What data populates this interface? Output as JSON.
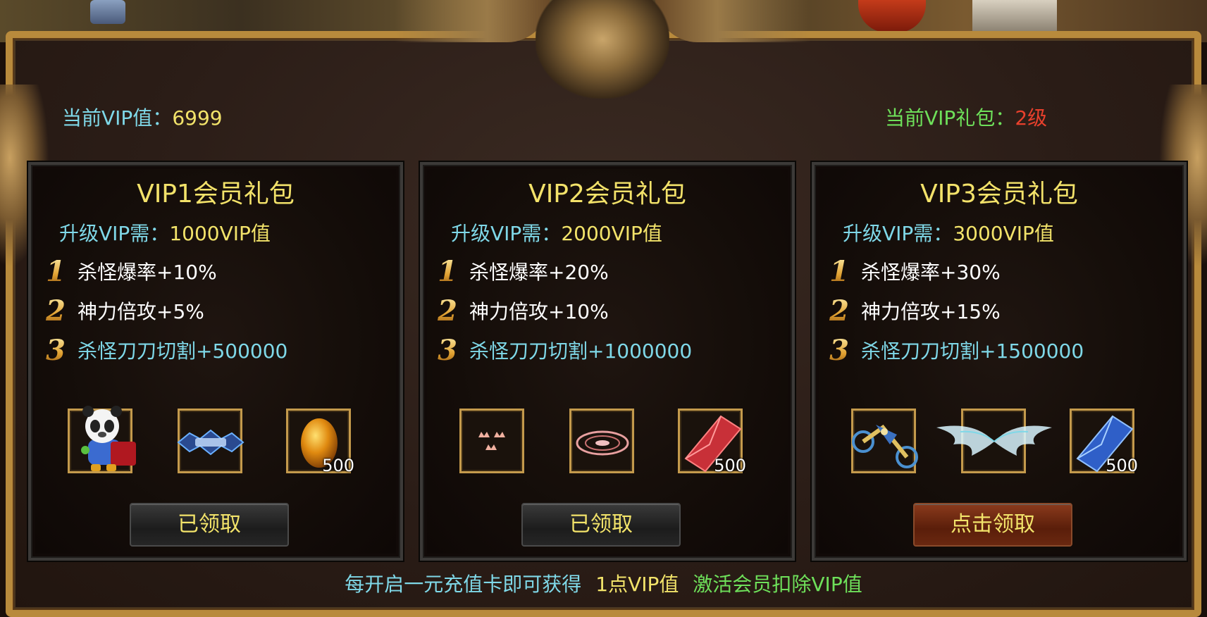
{
  "header": {
    "vip_value_label": "当前VIP值：",
    "vip_value": "6999",
    "gift_level_label": "当前VIP礼包：",
    "gift_level": "2级"
  },
  "packs": [
    {
      "title": "VIP1会员礼包",
      "req_label": "升级VIP需：",
      "req_value": "1000VIP值",
      "benefits": [
        {
          "num": "1",
          "text": "杀怪爆率+10%"
        },
        {
          "num": "2",
          "text": "神力倍攻+5%"
        },
        {
          "num": "3",
          "text": "杀怪刀刀切割+500000"
        }
      ],
      "items": [
        {
          "icon": "panda-pet-icon",
          "count": ""
        },
        {
          "icon": "title-badge-icon",
          "count": ""
        },
        {
          "icon": "golden-egg-icon",
          "count": "500"
        }
      ],
      "button": "已领取",
      "button_state": "claimed"
    },
    {
      "title": "VIP2会员礼包",
      "req_label": "升级VIP需：",
      "req_value": "2000VIP值",
      "benefits": [
        {
          "num": "1",
          "text": "杀怪爆率+20%"
        },
        {
          "num": "2",
          "text": "神力倍攻+10%"
        },
        {
          "num": "3",
          "text": "杀怪刀刀切割+1000000"
        }
      ],
      "items": [
        {
          "icon": "crowns-icon",
          "count": ""
        },
        {
          "icon": "magic-circle-icon",
          "count": ""
        },
        {
          "icon": "red-gem-icon",
          "count": "500"
        }
      ],
      "button": "已领取",
      "button_state": "claimed"
    },
    {
      "title": "VIP3会员礼包",
      "req_label": "升级VIP需：",
      "req_value": "3000VIP值",
      "benefits": [
        {
          "num": "1",
          "text": "杀怪爆率+30%"
        },
        {
          "num": "2",
          "text": "神力倍攻+15%"
        },
        {
          "num": "3",
          "text": "杀怪刀刀切割+1500000"
        }
      ],
      "items": [
        {
          "icon": "motorcycle-mount-icon",
          "count": ""
        },
        {
          "icon": "angel-wings-icon",
          "count": ""
        },
        {
          "icon": "blue-gem-icon",
          "count": "500"
        }
      ],
      "button": "点击领取",
      "button_state": "claimable"
    }
  ],
  "footer": {
    "text1": "每开启一元充值卡即可获得",
    "text2": "1点VIP值",
    "text3": "激活会员扣除VIP值"
  },
  "colors": {
    "cyan": "#7fd8e8",
    "yellow": "#f2e36a",
    "green": "#6ee05a",
    "red": "#e8402c",
    "frame_gold": "#b88a3c"
  }
}
